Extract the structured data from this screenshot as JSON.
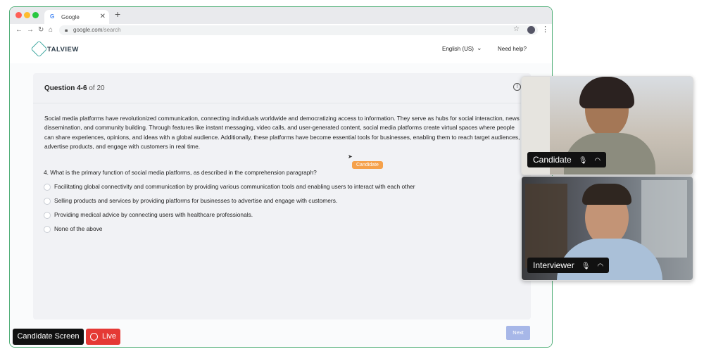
{
  "browser": {
    "tab_title": "Google",
    "tab_close": "✕",
    "new_tab": "+",
    "url_domain": "google.com",
    "url_path": "/search"
  },
  "header": {
    "logo": "TALVIEW",
    "language": "English (US)",
    "help": "Need help?"
  },
  "question": {
    "heading_range": "Question 4-6",
    "heading_total": " of 20",
    "passage": "Social media platforms have revolutionized communication, connecting individuals worldwide and democratizing access to information. They serve as hubs for social interaction, news dissemination, and community building. Through features like instant messaging, video calls, and user-generated content, social media platforms create virtual spaces where people can share experiences, opinions, and ideas with a global audience. Additionally, these platforms have become essential tools for businesses, enabling them to reach target audiences, advertise products, and engage with customers in real time.",
    "prompt": "4. What is the primary function of social media platforms, as described in the comprehension paragraph?",
    "options": [
      "Facilitating global connectivity and communication by providing various communication tools and enabling users to interact with each other",
      "Selling products and services by providing platforms for businesses to advertise and engage with customers.",
      "Providing medical advice by connecting users with healthcare professionals.",
      "None of the above"
    ],
    "cursor_tag": "Candidate",
    "next": "Next"
  },
  "badges": {
    "screen": "Candidate Screen",
    "live": "Live"
  },
  "videos": {
    "candidate_label": "Candidate",
    "interviewer_label": "Interviewer"
  }
}
